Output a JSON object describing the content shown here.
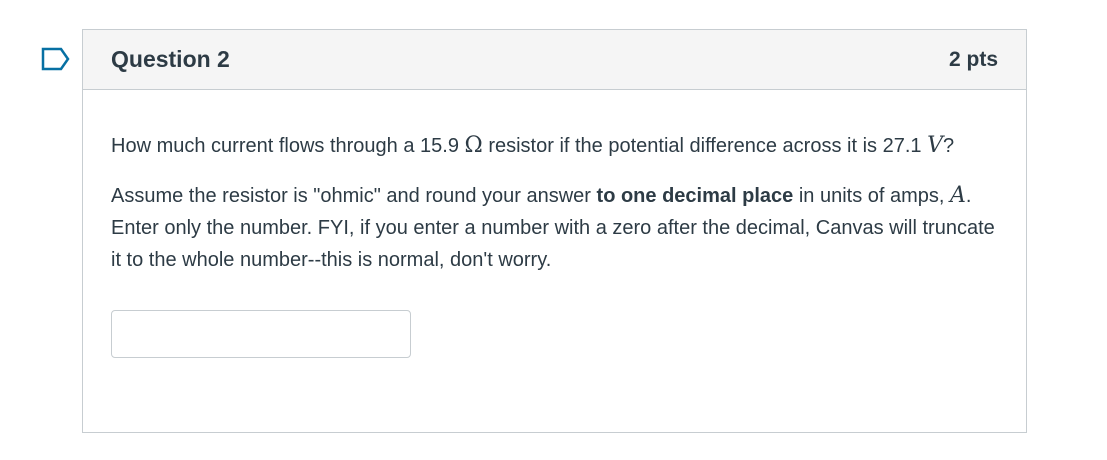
{
  "question": {
    "title": "Question 2",
    "points": "2 pts",
    "paragraph1": {
      "pre": "How much current flows through a 15.9 ",
      "unit_ohm": "Ω",
      "mid": " resistor if the potential difference across it is 27.1 ",
      "unit_volt": "V",
      "post": "?"
    },
    "paragraph2": {
      "pre": "Assume the resistor is \"ohmic\" and round your answer ",
      "bold": "to one decimal place",
      "mid": " in units of amps, ",
      "unit_amp": "A",
      "post": ". Enter only the number. FYI, if you enter a number with a zero after the decimal, Canvas will truncate it to the whole number--this is normal, don't worry."
    },
    "answer_value": ""
  },
  "icons": {
    "flag": "bookmark-flag-icon"
  },
  "colors": {
    "text": "#2d3b45",
    "border": "#c7cdd1",
    "header_bg": "#f5f5f5",
    "flag": "#0770a3"
  }
}
